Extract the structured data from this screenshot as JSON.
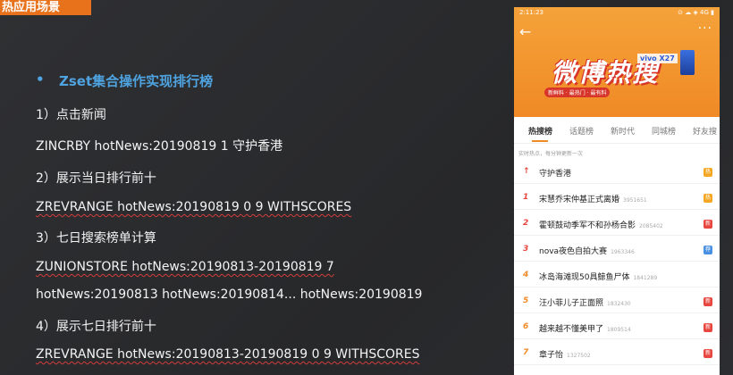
{
  "slide": {
    "title_tab": "热应用场景",
    "bullet": "Zset集合操作实现排行榜",
    "lines": [
      "1）点击新闻",
      "ZINCRBY  hotNews:20190819  1  守护香港",
      "2）展示当日排行前十",
      "ZREVRANGE  hotNews:20190819  0  9  WITHSCORES",
      "3）七日搜索榜单计算",
      "ZUNIONSTORE  hotNews:20190813-20190819  7",
      "hotNews:20190813  hotNews:20190814... hotNews:20190819",
      "4）展示七日排行前十",
      "ZREVRANGE hotNews:20190813-20190819  0  9  WITHSCORES"
    ]
  },
  "phone": {
    "status_time": "2:11:23",
    "status_icons": "⊙ ☁ ◈ 4G ▮",
    "back_icon": "arrow-left-icon",
    "more_icon": "more-dots-icon",
    "banner_main": "微博热搜",
    "banner_brand": "vivo X27",
    "banner_sub": "新鲜料 · 最热门 · 最有料",
    "tabs": [
      "热搜榜",
      "话题榜",
      "新时代",
      "同城榜",
      "好友搜"
    ],
    "subtitle": "实时热点，每分钟更新一次",
    "items": [
      {
        "rank": "↑",
        "title": "守护香港",
        "count": "",
        "badge": "热",
        "badge_color": "#f5a623"
      },
      {
        "rank": "1",
        "title": "宋慧乔宋仲基正式离婚",
        "count": "3951651",
        "badge": "热",
        "badge_color": "#f5a623"
      },
      {
        "rank": "2",
        "title": "霍顿鼓动季军不和孙杨合影",
        "count": "2085402",
        "badge": "新",
        "badge_color": "#e8473f"
      },
      {
        "rank": "3",
        "title": "nova夜色自拍大赛",
        "count": "1963346",
        "badge": "荐",
        "badge_color": "#4a90e2"
      },
      {
        "rank": "4",
        "title": "冰岛海滩现50具鲸鱼尸体",
        "count": "1841289",
        "badge": "",
        "badge_color": ""
      },
      {
        "rank": "5",
        "title": "汪小菲儿子正面照",
        "count": "1832430",
        "badge": "新",
        "badge_color": "#e8473f"
      },
      {
        "rank": "6",
        "title": "越来越不懂美甲了",
        "count": "1809514",
        "badge": "新",
        "badge_color": "#e8473f"
      },
      {
        "rank": "7",
        "title": "章子怡",
        "count": "1327502",
        "badge": "新",
        "badge_color": "#e8473f"
      }
    ]
  },
  "colors": {
    "accent_orange": "#e8721c",
    "bullet_blue": "#4ea3e0",
    "rank_red": "#e8473f",
    "rank_orange": "#f08a26"
  }
}
